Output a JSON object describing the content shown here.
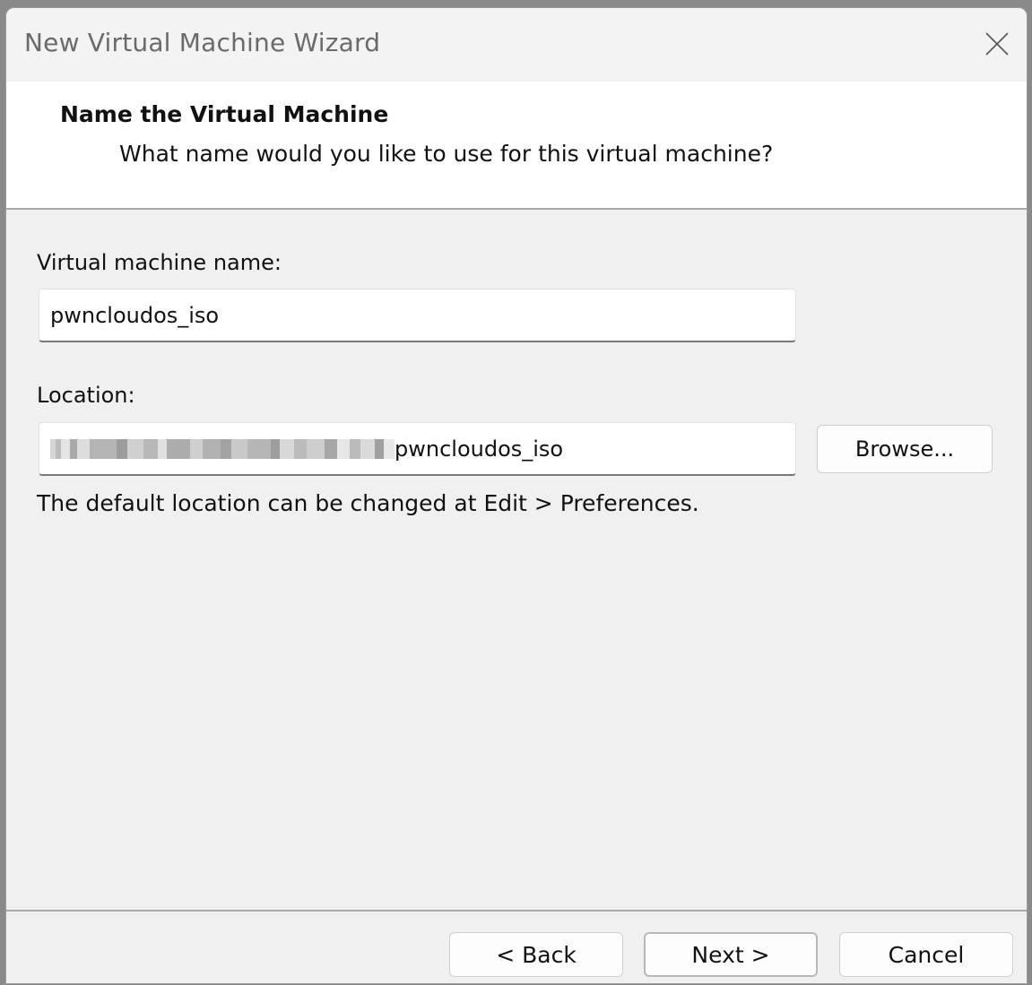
{
  "window": {
    "title": "New Virtual Machine Wizard"
  },
  "header": {
    "title": "Name the Virtual Machine",
    "subtitle": "What name would you like to use for this virtual machine?"
  },
  "form": {
    "name_label": "Virtual machine name:",
    "name_value": "pwncloudos_iso",
    "location_label": "Location:",
    "location_value_suffix": "pwncloudos_iso",
    "location_hint": "The default location can be changed at Edit > Preferences.",
    "browse_label": "Browse..."
  },
  "footer": {
    "back_label": "< Back",
    "next_label": "Next >",
    "cancel_label": "Cancel"
  },
  "icons": {
    "close": "close-icon"
  },
  "colors": {
    "window_bg": "#f0f0f0",
    "header_bg": "#ffffff",
    "title_text": "#6a6a6a"
  }
}
